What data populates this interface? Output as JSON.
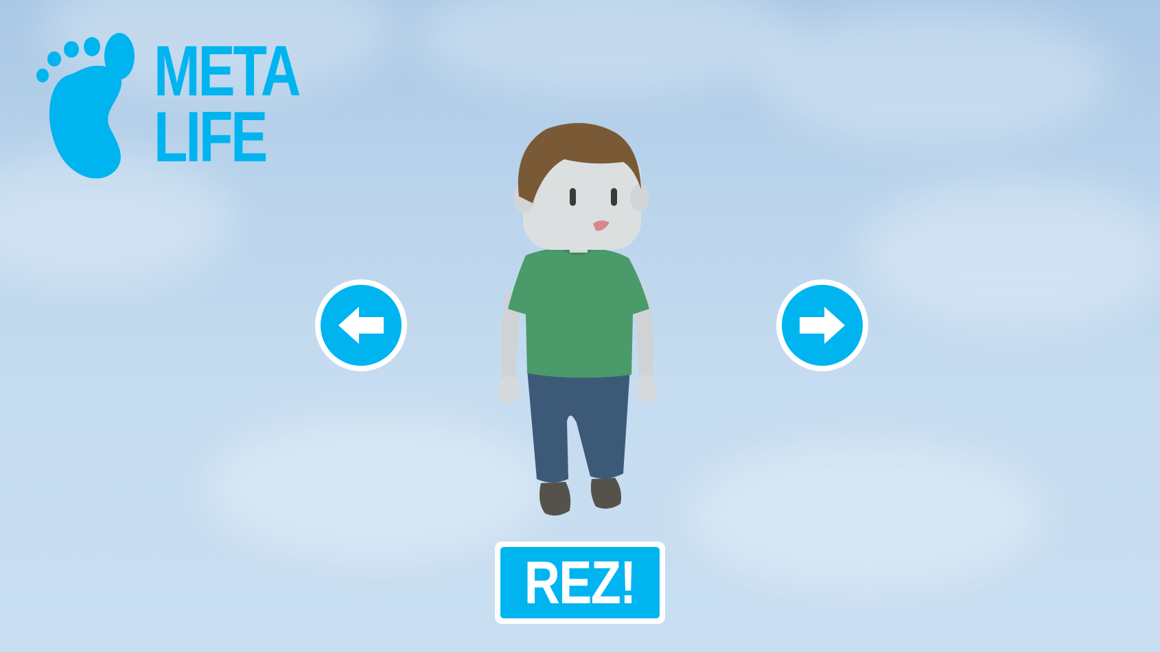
{
  "logo": {
    "line1": "META",
    "line2": "LIFE",
    "icon": "footprint-icon",
    "color": "#00b4f0"
  },
  "navigation": {
    "prev_icon": "arrow-left-icon",
    "next_icon": "arrow-right-icon"
  },
  "character": {
    "shirt_color": "#4a9a6a",
    "pants_color": "#3c5a78",
    "hair_color": "#7a5a36"
  },
  "actions": {
    "confirm_label": "REZ!"
  },
  "colors": {
    "accent": "#00b4f0",
    "button_border": "#ffffff"
  }
}
